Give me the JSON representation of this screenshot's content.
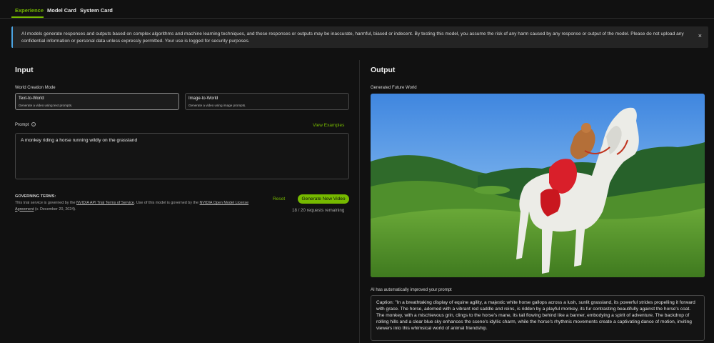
{
  "tabs": [
    {
      "label": "Experience"
    },
    {
      "label": "Model Card"
    },
    {
      "label": "System Card"
    }
  ],
  "notice": {
    "text": "AI models generate responses and outputs based on complex algorithms and machine learning techniques, and those responses or outputs may be inaccurate, harmful, biased or indecent. By testing this model, you assume the risk of any harm caused by any response or output of the model. Please do not upload any confidential information or personal data unless expressly permitted. Your use is logged for security purposes.",
    "close_symbol": "×"
  },
  "input": {
    "title": "Input",
    "mode_label": "World Creation Mode",
    "modes": [
      {
        "title": "Text-to-World",
        "desc": "Generate a video using text prompts."
      },
      {
        "title": "Image-to-World",
        "desc": "Generate a video using image prompts."
      }
    ],
    "prompt_label": "Prompt",
    "info_symbol": "i",
    "view_examples": "View Examples",
    "prompt_value": "A monkey riding a horse running wildly on the grassland",
    "terms_title": "GOVERNING TERMS:",
    "terms_part1": "This trial service is governed by the ",
    "terms_link1": "NVIDIA API Trial Terms of Service",
    "terms_part2": ". Use of this model is governed by the ",
    "terms_link2": "NVIDIA Open Model License Agreement",
    "terms_part3": " (v. December 20, 2024).",
    "reset_label": "Reset",
    "generate_label": "Generate New Video",
    "requests_remaining": "18 / 20 requests remaining"
  },
  "output": {
    "title": "Output",
    "world_label": "Generated Future World",
    "improved_label": "AI has automatically improved your prompt",
    "caption": "Caption: \"In a breathtaking display of equine agility, a majestic white horse gallops across a lush, sunlit grassland, its powerful strides propelling it forward with grace. The horse, adorned with a vibrant red saddle and reins, is ridden by a playful monkey, its fur contrasting beautifully against the horse's coat. The monkey, with a mischievous grin, clings to the horse's mane, its tail flowing behind like a banner, embodying a spirit of adventure. The backdrop of rolling hills and a clear blue sky enhances the scene's idyllic charm, while the horse's rhythmic movements create a captivating dance of motion, inviting viewers into this whimsical world of animal friendship."
  },
  "colors": {
    "accent": "#76b900",
    "background": "#111111",
    "notice_border": "#4ba3e0"
  }
}
